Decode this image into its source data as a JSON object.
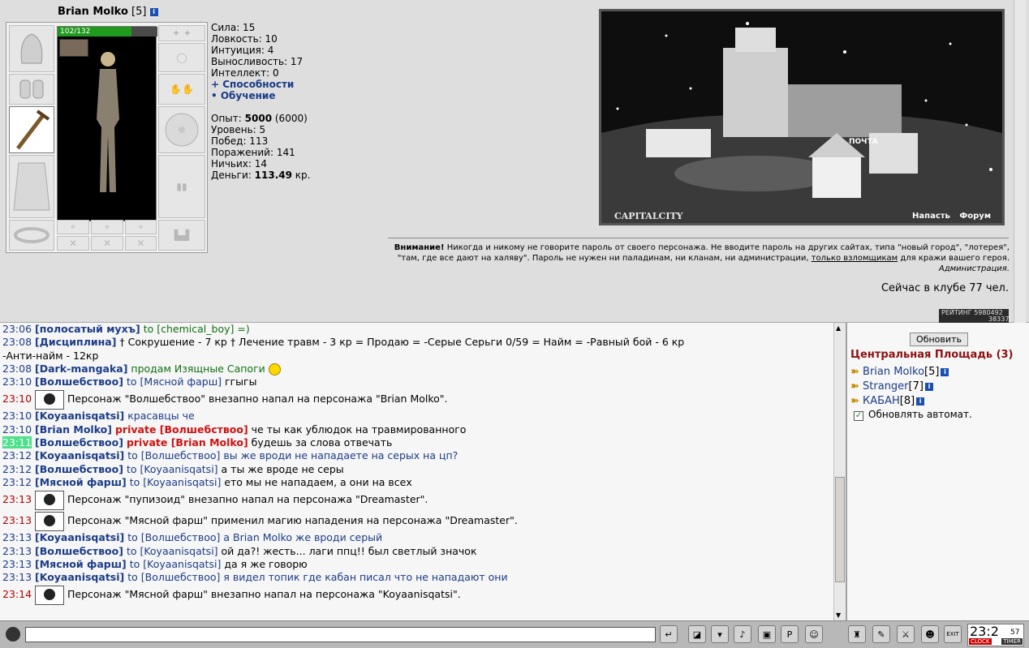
{
  "character": {
    "name": "Brian Molko",
    "level": "[5]",
    "hp": "102/132"
  },
  "stats": {
    "strength": "Сила: 15",
    "agility": "Ловкость: 10",
    "intuition": "Интуиция: 4",
    "endurance": "Выносливость: 17",
    "intellect": "Интеллект: 0",
    "abilities_link": "+ Способности",
    "training_link": "• Обучение"
  },
  "progress": {
    "exp_label": "Опыт:",
    "exp_value": "5000",
    "exp_next": "(6000)",
    "level": "Уровень: 5",
    "wins": "Побед: 113",
    "losses": "Поражений: 141",
    "draws": "Ничьих: 14",
    "money_label": "Деньги:",
    "money_value": "113.49",
    "money_unit": "кр."
  },
  "scene": {
    "location": "CAPITALCITY",
    "sign": "ПОЧТА",
    "links": [
      "Напасть",
      "Форум"
    ]
  },
  "warning": {
    "bold": "Внимание!",
    "text1": " Никогда и никому не говорите пароль от своего персонажа. Не вводите пароль на других сайтах, типа \"новый город\", \"лотерея\", \"там, где все дают на халяву\". Пароль не нужен ни паладинам, ни кланам, ни администрации, ",
    "underlined": "только взломщикам",
    "text2": " для кражи вашего героя.",
    "sign": "Администрация."
  },
  "online_text": "Сейчас в клубе 77 чел.",
  "rating": {
    "label": "РЕЙТИНГ",
    "value": "5980492",
    "value2": "38337"
  },
  "chat": [
    {
      "time": "23:06",
      "nick": "полосатый мухъ",
      "to": "to [chemical_boy]",
      "msg": "=)",
      "kind": "green"
    },
    {
      "time": "23:08",
      "nick": "Дисциплина",
      "msg": " † Сокрушение - 7 кр † Лечение травм - 3 кр  = Продаю = -Серые Серьги 0/59  = Найм = -Равный бой - 6 кр",
      "cont": "-Анти-найм - 12кр",
      "kind": "ad"
    },
    {
      "time": "23:08",
      "nick": "Dark-mangaka",
      "msg": "продам Изящные Сапоги",
      "kind": "green"
    },
    {
      "time": "23:10",
      "nick": "Волшебствоо",
      "to": "to [Мясной фарш]",
      "msg": "ггыгы",
      "kind": "normal"
    },
    {
      "time": "23:10",
      "msg": "Персонаж \"Волшебствоо\" внезапно напал на персонажа \"Brian Molko\".",
      "kind": "system"
    },
    {
      "time": "23:10",
      "nick": "Koyaanisqatsi",
      "msg": "красавцы че",
      "kind": "blue"
    },
    {
      "time": "23:10",
      "nick": "Brian Molko",
      "priv": "private [Волшебствоо]",
      "msg": "че ты как ублюдок на травмированного",
      "kind": "private"
    },
    {
      "time": "23:11",
      "nick": "Волшебствоо",
      "priv": "private [Brian Molko]",
      "msg": "будешь за слова отвечать",
      "kind": "private-hl"
    },
    {
      "time": "23:12",
      "nick": "Koyaanisqatsi",
      "to": "to [Волшебствоо]",
      "msg": "вы же вроди не нападаете на серых на цп?",
      "kind": "blue"
    },
    {
      "time": "23:12",
      "nick": "Волшебствоо",
      "to": "to [Koyaanisqatsi]",
      "msg": "а ты же вроде не серы",
      "kind": "normal"
    },
    {
      "time": "23:12",
      "nick": "Мясной фарш",
      "to": "to [Koyaanisqatsi]",
      "msg": "ето мы не нападаем, а они на всех",
      "kind": "normal"
    },
    {
      "time": "23:13",
      "msg": "Персонаж \"пупизоид\" внезапно напал на персонажа \"Dreamaster\".",
      "kind": "system"
    },
    {
      "time": "23:13",
      "msg": "Персонаж \"Мясной фарш\" применил магию нападения на персонажа \"Dreamaster\".",
      "kind": "system"
    },
    {
      "time": "23:13",
      "nick": "Koyaanisqatsi",
      "to": "to [Волшебствоо]",
      "msg": "а Brian Molko же вроди серый",
      "kind": "blue"
    },
    {
      "time": "23:13",
      "nick": "Волшебствоо",
      "to": "to [Koyaanisqatsi]",
      "msg": "ой да?! жесть... лаги ппц!! был светлый значок",
      "kind": "normal"
    },
    {
      "time": "23:13",
      "nick": "Мясной фарш",
      "to": "to [Koyaanisqatsi]",
      "msg": "да я же говорю",
      "kind": "normal"
    },
    {
      "time": "23:13",
      "nick": "Koyaanisqatsi",
      "to": "to [Волшебствоо]",
      "msg": "я видел топик где кабан писал что не нападают они",
      "kind": "blue"
    },
    {
      "time": "23:14",
      "msg": "Персонаж \"Мясной фарш\" внезапно напал на персонажа \"Koyaanisqatsi\".",
      "kind": "system"
    }
  ],
  "room": {
    "refresh_label": "Обновить",
    "title": "Центральная Площадь (3)",
    "players": [
      {
        "name": "Brian Molko",
        "level": "[5]"
      },
      {
        "name": "Stranger",
        "level": "[7]"
      },
      {
        "name": "КАБАН",
        "level": "[8]"
      }
    ],
    "auto_label": "Обновлять автомат."
  },
  "clock": {
    "time": "23:2",
    "seconds": "57",
    "label1": "CLOCK",
    "label2": "TIMER",
    "exit": "EXIT"
  },
  "toolbar_icons": [
    "enter-icon",
    "eraser-icon",
    "filter-icon",
    "sound-icon",
    "save-icon",
    "translit-icon",
    "smile-icon",
    "bag-icon",
    "scroll-icon",
    "fight-icon",
    "friends-icon",
    "exit-icon"
  ]
}
